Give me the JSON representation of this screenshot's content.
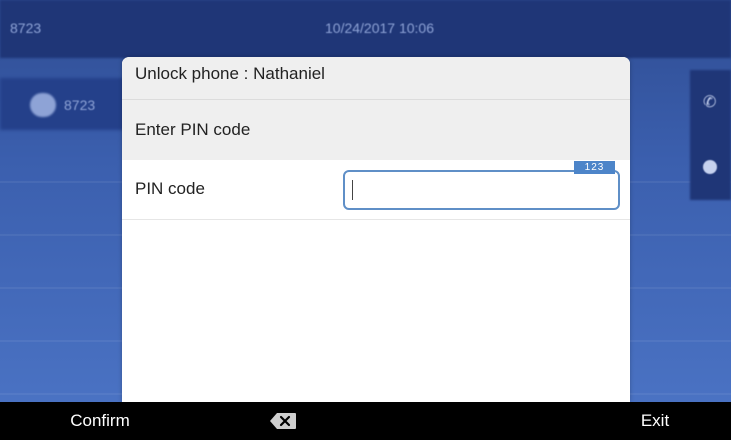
{
  "background": {
    "line_number": "8723",
    "datetime": "10/24/2017 10:06",
    "line_button_label": "8723"
  },
  "dialog": {
    "title": "Unlock phone : Nathaniel",
    "section_header": "Enter PIN code",
    "field": {
      "label": "PIN code",
      "value": "",
      "input_mode": "123"
    }
  },
  "softkeys": {
    "confirm": "Confirm",
    "backspace": "backspace-icon",
    "exit": "Exit"
  },
  "colors": {
    "background_blue": "#3b5fae",
    "accent_blue": "#4d85c9",
    "softkey_bar": "#000000"
  }
}
